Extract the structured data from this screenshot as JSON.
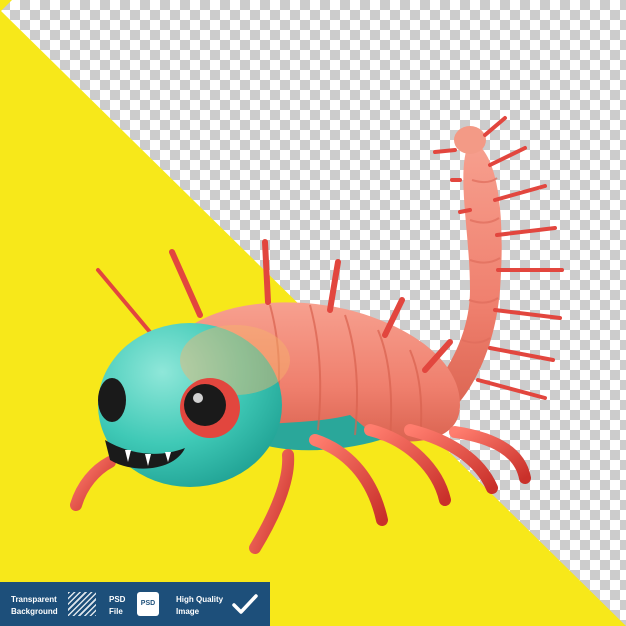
{
  "image": {
    "subject": "cartoon centipede",
    "colors": {
      "background_yellow": "#f7e81a",
      "checker_light": "#ffffff",
      "checker_dark": "#cccccc",
      "body_pink": "#f08473",
      "head_teal": "#3fc9b6",
      "legs_red": "#e2463e",
      "footer_blue": "#1d4f7a"
    }
  },
  "footer": {
    "transparent_line1": "Transparent",
    "transparent_line2": "Background",
    "psd_line1": "PSD",
    "psd_line2": "File",
    "psd_icon_label": "PSD",
    "quality_line1": "High Quality",
    "quality_line2": "Image",
    "icons": [
      "transparency-hatch-icon",
      "psd-file-icon",
      "checkmark-icon"
    ]
  }
}
